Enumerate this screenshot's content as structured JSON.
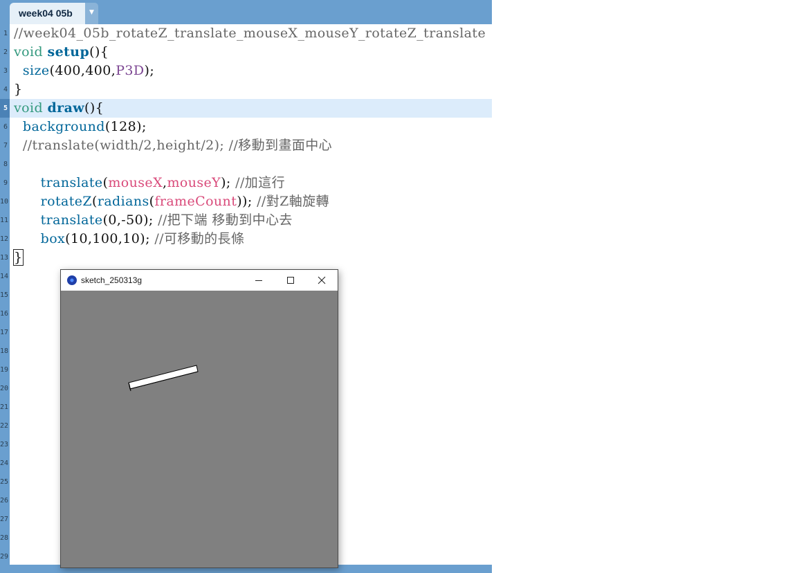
{
  "editor": {
    "tab_label": "week04 05b",
    "tab_menu_icon": "dropdown-arrow-icon",
    "line_numbers": [
      "1",
      "2",
      "3",
      "4",
      "5",
      "6",
      "7",
      "8",
      "9",
      "10",
      "11",
      "12",
      "13",
      "14",
      "15",
      "16",
      "17",
      "18",
      "19",
      "20",
      "21",
      "22",
      "23",
      "24",
      "25",
      "26",
      "27",
      "28",
      "29"
    ],
    "current_line": 5,
    "code": {
      "l1": "//week04_05b_rotateZ_translate_mouseX_mouseY_rotateZ_translate",
      "l2_kw": "void",
      "l2_fn": "setup",
      "l2_rest": "(){",
      "l3_fn": "size",
      "l3_a": "(400,400,",
      "l3_cst": "P3D",
      "l3_b": ");",
      "l4": "}",
      "l5_kw": "void",
      "l5_fn": "draw",
      "l5_rest": "(){",
      "l6_fn": "background",
      "l6_rest": "(128);",
      "l7_cm": "//translate(width/2,height/2); //移動到畫面中心",
      "l9_fn": "translate",
      "l9_a": "(",
      "l9_v1": "mouseX",
      "l9_b": ",",
      "l9_v2": "mouseY",
      "l9_c": "); ",
      "l9_cm": "//加這行",
      "l10_fn1": "rotateZ",
      "l10_a": "(",
      "l10_fn2": "radians",
      "l10_b": "(",
      "l10_v": "frameCount",
      "l10_c": ")); ",
      "l10_cm": "//對Z軸旋轉",
      "l11_fn": "translate",
      "l11_a": "(0,-50); ",
      "l11_cm": "//把下端 移動到中心去",
      "l12_fn": "box",
      "l12_a": "(10,100,10); ",
      "l12_cm": "//可移動的長條",
      "l13": "}"
    }
  },
  "sketch_window": {
    "title": "sketch_250313g",
    "app_icon": "processing-icon",
    "minimize_icon": "minimize-icon",
    "maximize_icon": "maximize-icon",
    "close_icon": "close-icon",
    "background_gray": 128,
    "canvas_bg": "#808080",
    "box_fill": "#ffffff",
    "box_stroke": "#000000"
  },
  "colors": {
    "chrome_blue": "#6a9fcf",
    "keyword": "#33997e",
    "function": "#006699",
    "constant": "#7d4793",
    "variable": "#d94a7a",
    "comment": "#666666",
    "current_line_bg": "#dcecfb"
  }
}
